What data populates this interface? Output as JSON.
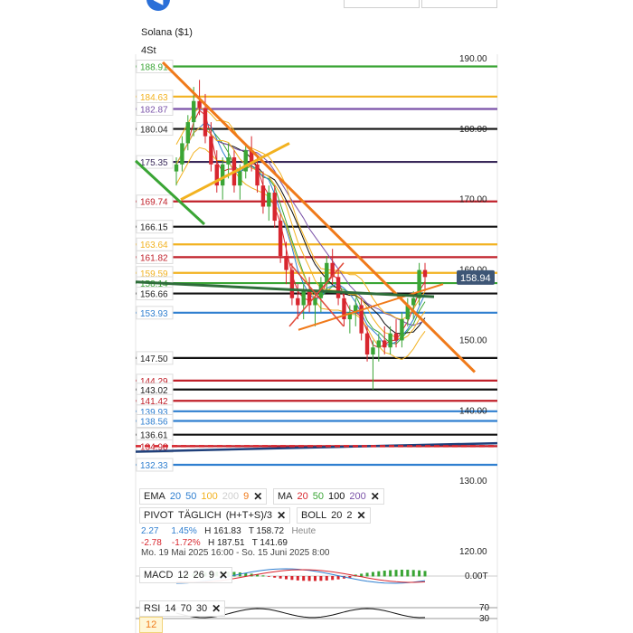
{
  "header": {
    "instrument": "Solana ($1)",
    "timeframe": "4St",
    "back_icon": "left-arrow-icon"
  },
  "chart_data": {
    "type": "candlestick",
    "title": "Solana ($1)",
    "ylim": [
      117.5,
      192.5
    ],
    "axis_ticks": [
      "190.00",
      "180.00",
      "170.00",
      "160.00",
      "150.00",
      "140.00",
      "130.00",
      "120.00"
    ],
    "axis_tick_values": [
      190,
      180,
      170,
      160,
      150,
      140,
      130,
      120
    ],
    "current_price": {
      "label": "158.94",
      "value": 158.94
    },
    "left_levels": [
      {
        "label": "188.91",
        "value": 188.91,
        "color": "#3aa535"
      },
      {
        "label": "184.63",
        "value": 184.63,
        "color": "#f2b220"
      },
      {
        "label": "182.87",
        "value": 182.87,
        "color": "#7a52a8"
      },
      {
        "label": "180.04",
        "value": 180.04,
        "color": "#111111"
      },
      {
        "label": "175.35",
        "value": 175.35,
        "color": "#3a2a5a"
      },
      {
        "label": "169.74",
        "value": 169.74,
        "color": "#c0202a"
      },
      {
        "label": "166.15",
        "value": 166.15,
        "color": "#111111"
      },
      {
        "label": "163.64",
        "value": 163.64,
        "color": "#f2b220"
      },
      {
        "label": "161.82",
        "value": 161.82,
        "color": "#c0202a"
      },
      {
        "label": "159.59",
        "value": 159.59,
        "color": "#f2b220"
      },
      {
        "label": "158.14",
        "value": 158.14,
        "color": "#3aa535"
      },
      {
        "label": "156.66",
        "value": 156.66,
        "color": "#111111"
      },
      {
        "label": "153.93",
        "value": 153.93,
        "color": "#2f7fd0"
      },
      {
        "label": "147.50",
        "value": 147.5,
        "color": "#111111"
      },
      {
        "label": "144.29",
        "value": 144.29,
        "color": "#c0202a"
      },
      {
        "label": "143.02",
        "value": 143.02,
        "color": "#111111"
      },
      {
        "label": "141.42",
        "value": 141.42,
        "color": "#c0202a"
      },
      {
        "label": "139.93",
        "value": 139.93,
        "color": "#2f7fd0"
      },
      {
        "label": "138.56",
        "value": 138.56,
        "color": "#2f7fd0"
      },
      {
        "label": "136.61",
        "value": 136.61,
        "color": "#111111"
      },
      {
        "label": "134.98",
        "value": 134.98,
        "color": "#c0202a"
      },
      {
        "label": "132.33",
        "value": 132.33,
        "color": "#2f7fd0"
      }
    ],
    "candles": [
      [
        174,
        176,
        172,
        175
      ],
      [
        175,
        179,
        174,
        178
      ],
      [
        178,
        182,
        177,
        181
      ],
      [
        181,
        186,
        179,
        184
      ],
      [
        184,
        187,
        182,
        183
      ],
      [
        183,
        185,
        178,
        179
      ],
      [
        179,
        181,
        174,
        175
      ],
      [
        175,
        177,
        171,
        172
      ],
      [
        172,
        176,
        170,
        175
      ],
      [
        175,
        178,
        173,
        176
      ],
      [
        176,
        177,
        171,
        172
      ],
      [
        172,
        175,
        170,
        174
      ],
      [
        174,
        178,
        173,
        177
      ],
      [
        177,
        179,
        174,
        175
      ],
      [
        175,
        176,
        171,
        172
      ],
      [
        172,
        174,
        168,
        169
      ],
      [
        169,
        172,
        167,
        171
      ],
      [
        171,
        172,
        166,
        167
      ],
      [
        167,
        168,
        161,
        162
      ],
      [
        162,
        164,
        158,
        160
      ],
      [
        160,
        161,
        155,
        156
      ],
      [
        156,
        158,
        153,
        155
      ],
      [
        155,
        158,
        153,
        157
      ],
      [
        157,
        159,
        154,
        155
      ],
      [
        155,
        157,
        152,
        156
      ],
      [
        156,
        159,
        154,
        158
      ],
      [
        158,
        162,
        157,
        161
      ],
      [
        161,
        163,
        158,
        159
      ],
      [
        159,
        160,
        155,
        156
      ],
      [
        156,
        157,
        152,
        153
      ],
      [
        153,
        155,
        151,
        154
      ],
      [
        154,
        156,
        152,
        155
      ],
      [
        155,
        156,
        150,
        151
      ],
      [
        151,
        152,
        147,
        148
      ],
      [
        148,
        150,
        143,
        149
      ],
      [
        149,
        151,
        147,
        150
      ],
      [
        150,
        152,
        148,
        149
      ],
      [
        149,
        152,
        148,
        151
      ],
      [
        151,
        153,
        149,
        150
      ],
      [
        150,
        154,
        149,
        153
      ],
      [
        153,
        156,
        152,
        155
      ],
      [
        155,
        157,
        153,
        156
      ],
      [
        156,
        161,
        155,
        160
      ],
      [
        160,
        161,
        157,
        159
      ]
    ]
  },
  "indicators": {
    "ema": {
      "label": "EMA",
      "p1": "20",
      "p2": "50",
      "p3": "100",
      "p4": "200",
      "p5": "9"
    },
    "ma": {
      "label": "MA",
      "p1": "20",
      "p2": "50",
      "p3": "100",
      "p4": "200"
    },
    "pivot": {
      "label": "PIVOT",
      "mode": "TÄGLICH",
      "formula": "(H+T+S)/3"
    },
    "boll": {
      "label": "BOLL",
      "p1": "20",
      "p2": "2"
    },
    "macd": {
      "label": "MACD",
      "p1": "12",
      "p2": "26",
      "p3": "9",
      "value": "0.00T"
    },
    "rsi": {
      "label": "RSI",
      "p1": "14",
      "p2": "70",
      "p3": "30",
      "upper": "70",
      "lower": "30",
      "period_box": "12"
    }
  },
  "info": {
    "change_abs_up": "2.27",
    "change_pct_up": "1.45%",
    "h1": "H 161.83",
    "t1": "T 158.72",
    "today": "Heute",
    "change_abs_dn": "-2.78",
    "change_pct_dn": "-1.72%",
    "h2": "H 187.51",
    "t2": "T 141.69",
    "range": "Mo. 19 Mai 2025 16:00 - So. 15 Juni 2025 8:00"
  },
  "colors": {
    "up": "#3aa535",
    "down": "#d8262e",
    "orange": "#f07a1a",
    "blue": "#2f7fd0",
    "purple": "#7a52a8",
    "yellow": "#f2b220"
  }
}
